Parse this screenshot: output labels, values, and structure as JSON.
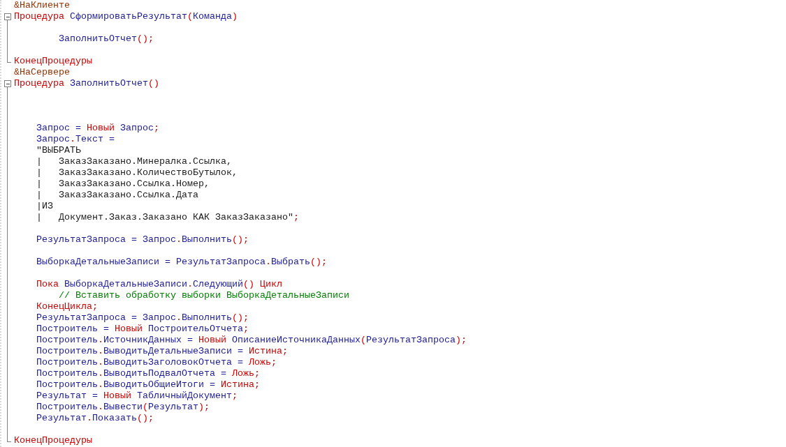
{
  "editor": {
    "lines": [
      {
        "kind": "plain",
        "tokens": [
          {
            "kind": "directive",
            "text": "&НаКлиенте"
          }
        ]
      },
      {
        "kind": "block-start",
        "tokens": [
          {
            "kind": "keyword",
            "text": "Процедура "
          },
          {
            "kind": "name",
            "text": "СформироватьРезультат"
          },
          {
            "kind": "punct",
            "text": "("
          },
          {
            "kind": "name",
            "text": "Команда"
          },
          {
            "kind": "punct",
            "text": ")"
          }
        ]
      },
      {
        "kind": "block-body"
      },
      {
        "kind": "block-body",
        "tokens": [
          {
            "kind": "name",
            "text": "        ЗаполнитьОтчет"
          },
          {
            "kind": "punct",
            "text": "();"
          }
        ]
      },
      {
        "kind": "block-body"
      },
      {
        "kind": "block-end",
        "tokens": [
          {
            "kind": "keyword",
            "text": "КонецПроцедуры"
          }
        ]
      },
      {
        "kind": "plain",
        "tokens": [
          {
            "kind": "directive",
            "text": "&НаСервере"
          }
        ]
      },
      {
        "kind": "block-start",
        "tokens": [
          {
            "kind": "keyword",
            "text": "Процедура "
          },
          {
            "kind": "name",
            "text": "ЗаполнитьОтчет"
          },
          {
            "kind": "punct",
            "text": "()"
          }
        ]
      },
      {
        "kind": "block-body"
      },
      {
        "kind": "block-body"
      },
      {
        "kind": "block-body"
      },
      {
        "kind": "block-body",
        "tokens": [
          {
            "kind": "name",
            "text": "    Запрос = "
          },
          {
            "kind": "keyword",
            "text": "Новый "
          },
          {
            "kind": "name",
            "text": "Запрос"
          },
          {
            "kind": "punct",
            "text": ";"
          }
        ]
      },
      {
        "kind": "block-body",
        "tokens": [
          {
            "kind": "name",
            "text": "    Запрос"
          },
          {
            "kind": "punct",
            "text": "."
          },
          {
            "kind": "name",
            "text": "Текст ="
          }
        ]
      },
      {
        "kind": "block-body",
        "tokens": [
          {
            "kind": "string",
            "text": "    \"ВЫБРАТЬ"
          }
        ]
      },
      {
        "kind": "block-body",
        "tokens": [
          {
            "kind": "string",
            "text": "    |   ЗаказЗаказано.Минералка.Ссылка,"
          }
        ]
      },
      {
        "kind": "block-body",
        "tokens": [
          {
            "kind": "string",
            "text": "    |   ЗаказЗаказано.КоличествоБутылок,"
          }
        ]
      },
      {
        "kind": "block-body",
        "tokens": [
          {
            "kind": "string",
            "text": "    |   ЗаказЗаказано.Ссылка.Номер,"
          }
        ]
      },
      {
        "kind": "block-body",
        "tokens": [
          {
            "kind": "string",
            "text": "    |   ЗаказЗаказано.Ссылка.Дата"
          }
        ]
      },
      {
        "kind": "block-body",
        "tokens": [
          {
            "kind": "string",
            "text": "    |ИЗ"
          }
        ]
      },
      {
        "kind": "block-body",
        "tokens": [
          {
            "kind": "string",
            "text": "    |   Документ.Заказ.Заказано КАК ЗаказЗаказано\""
          },
          {
            "kind": "punct",
            "text": ";"
          }
        ]
      },
      {
        "kind": "block-body"
      },
      {
        "kind": "block-body",
        "tokens": [
          {
            "kind": "name",
            "text": "    РезультатЗапроса = Запрос"
          },
          {
            "kind": "punct",
            "text": "."
          },
          {
            "kind": "name",
            "text": "Выполнить"
          },
          {
            "kind": "punct",
            "text": "();"
          }
        ]
      },
      {
        "kind": "block-body"
      },
      {
        "kind": "block-body",
        "tokens": [
          {
            "kind": "name",
            "text": "    ВыборкаДетальныеЗаписи = РезультатЗапроса"
          },
          {
            "kind": "punct",
            "text": "."
          },
          {
            "kind": "name",
            "text": "Выбрать"
          },
          {
            "kind": "punct",
            "text": "();"
          }
        ]
      },
      {
        "kind": "block-body"
      },
      {
        "kind": "block-body",
        "tokens": [
          {
            "kind": "keyword",
            "text": "    Пока "
          },
          {
            "kind": "name",
            "text": "ВыборкаДетальныеЗаписи"
          },
          {
            "kind": "punct",
            "text": "."
          },
          {
            "kind": "name",
            "text": "Следующий"
          },
          {
            "kind": "punct",
            "text": "() "
          },
          {
            "kind": "keyword",
            "text": "Цикл"
          }
        ]
      },
      {
        "kind": "block-body",
        "tokens": [
          {
            "kind": "comment",
            "text": "        // Вставить обработку выборки ВыборкаДетальныеЗаписи"
          }
        ]
      },
      {
        "kind": "block-body",
        "tokens": [
          {
            "kind": "keyword",
            "text": "    КонецЦикла"
          },
          {
            "kind": "punct",
            "text": ";"
          }
        ]
      },
      {
        "kind": "block-body",
        "tokens": [
          {
            "kind": "name",
            "text": "    РезультатЗапроса = Запрос"
          },
          {
            "kind": "punct",
            "text": "."
          },
          {
            "kind": "name",
            "text": "Выполнить"
          },
          {
            "kind": "punct",
            "text": "();"
          }
        ]
      },
      {
        "kind": "block-body",
        "tokens": [
          {
            "kind": "name",
            "text": "    Построитель = "
          },
          {
            "kind": "keyword",
            "text": "Новый "
          },
          {
            "kind": "name",
            "text": "ПостроительОтчета"
          },
          {
            "kind": "punct",
            "text": ";"
          }
        ]
      },
      {
        "kind": "block-body",
        "tokens": [
          {
            "kind": "name",
            "text": "    Построитель"
          },
          {
            "kind": "punct",
            "text": "."
          },
          {
            "kind": "name",
            "text": "ИсточникДанных = "
          },
          {
            "kind": "keyword",
            "text": "Новый "
          },
          {
            "kind": "name",
            "text": "ОписаниеИсточникаДанных"
          },
          {
            "kind": "punct",
            "text": "("
          },
          {
            "kind": "name",
            "text": "РезультатЗапроса"
          },
          {
            "kind": "punct",
            "text": ");"
          }
        ]
      },
      {
        "kind": "block-body",
        "tokens": [
          {
            "kind": "name",
            "text": "    Построитель"
          },
          {
            "kind": "punct",
            "text": "."
          },
          {
            "kind": "name",
            "text": "ВыводитьДетальныеЗаписи = "
          },
          {
            "kind": "keyword",
            "text": "Истина"
          },
          {
            "kind": "punct",
            "text": ";"
          }
        ]
      },
      {
        "kind": "block-body",
        "tokens": [
          {
            "kind": "name",
            "text": "    Построитель"
          },
          {
            "kind": "punct",
            "text": "."
          },
          {
            "kind": "name",
            "text": "ВыводитьЗаголовокОтчета = "
          },
          {
            "kind": "keyword",
            "text": "Ложь"
          },
          {
            "kind": "punct",
            "text": ";"
          }
        ]
      },
      {
        "kind": "block-body",
        "tokens": [
          {
            "kind": "name",
            "text": "    Построитель"
          },
          {
            "kind": "punct",
            "text": "."
          },
          {
            "kind": "name",
            "text": "ВыводитьПодвалОтчета = "
          },
          {
            "kind": "keyword",
            "text": "Ложь"
          },
          {
            "kind": "punct",
            "text": ";"
          }
        ]
      },
      {
        "kind": "block-body",
        "tokens": [
          {
            "kind": "name",
            "text": "    Построитель"
          },
          {
            "kind": "punct",
            "text": "."
          },
          {
            "kind": "name",
            "text": "ВыводитьОбщиеИтоги = "
          },
          {
            "kind": "keyword",
            "text": "Истина"
          },
          {
            "kind": "punct",
            "text": ";"
          }
        ]
      },
      {
        "kind": "block-body",
        "tokens": [
          {
            "kind": "name",
            "text": "    Результат = "
          },
          {
            "kind": "keyword",
            "text": "Новый "
          },
          {
            "kind": "name",
            "text": "ТабличныйДокумент"
          },
          {
            "kind": "punct",
            "text": ";"
          }
        ]
      },
      {
        "kind": "block-body",
        "tokens": [
          {
            "kind": "name",
            "text": "    Построитель"
          },
          {
            "kind": "punct",
            "text": "."
          },
          {
            "kind": "name",
            "text": "Вывести"
          },
          {
            "kind": "punct",
            "text": "("
          },
          {
            "kind": "name",
            "text": "Результат"
          },
          {
            "kind": "punct",
            "text": ");"
          }
        ]
      },
      {
        "kind": "block-body",
        "tokens": [
          {
            "kind": "name",
            "text": "    Результат"
          },
          {
            "kind": "punct",
            "text": "."
          },
          {
            "kind": "name",
            "text": "Показать"
          },
          {
            "kind": "punct",
            "text": "();"
          }
        ]
      },
      {
        "kind": "block-body"
      },
      {
        "kind": "block-end",
        "tokens": [
          {
            "kind": "keyword",
            "text": "КонецПроцедуры"
          }
        ]
      }
    ]
  }
}
